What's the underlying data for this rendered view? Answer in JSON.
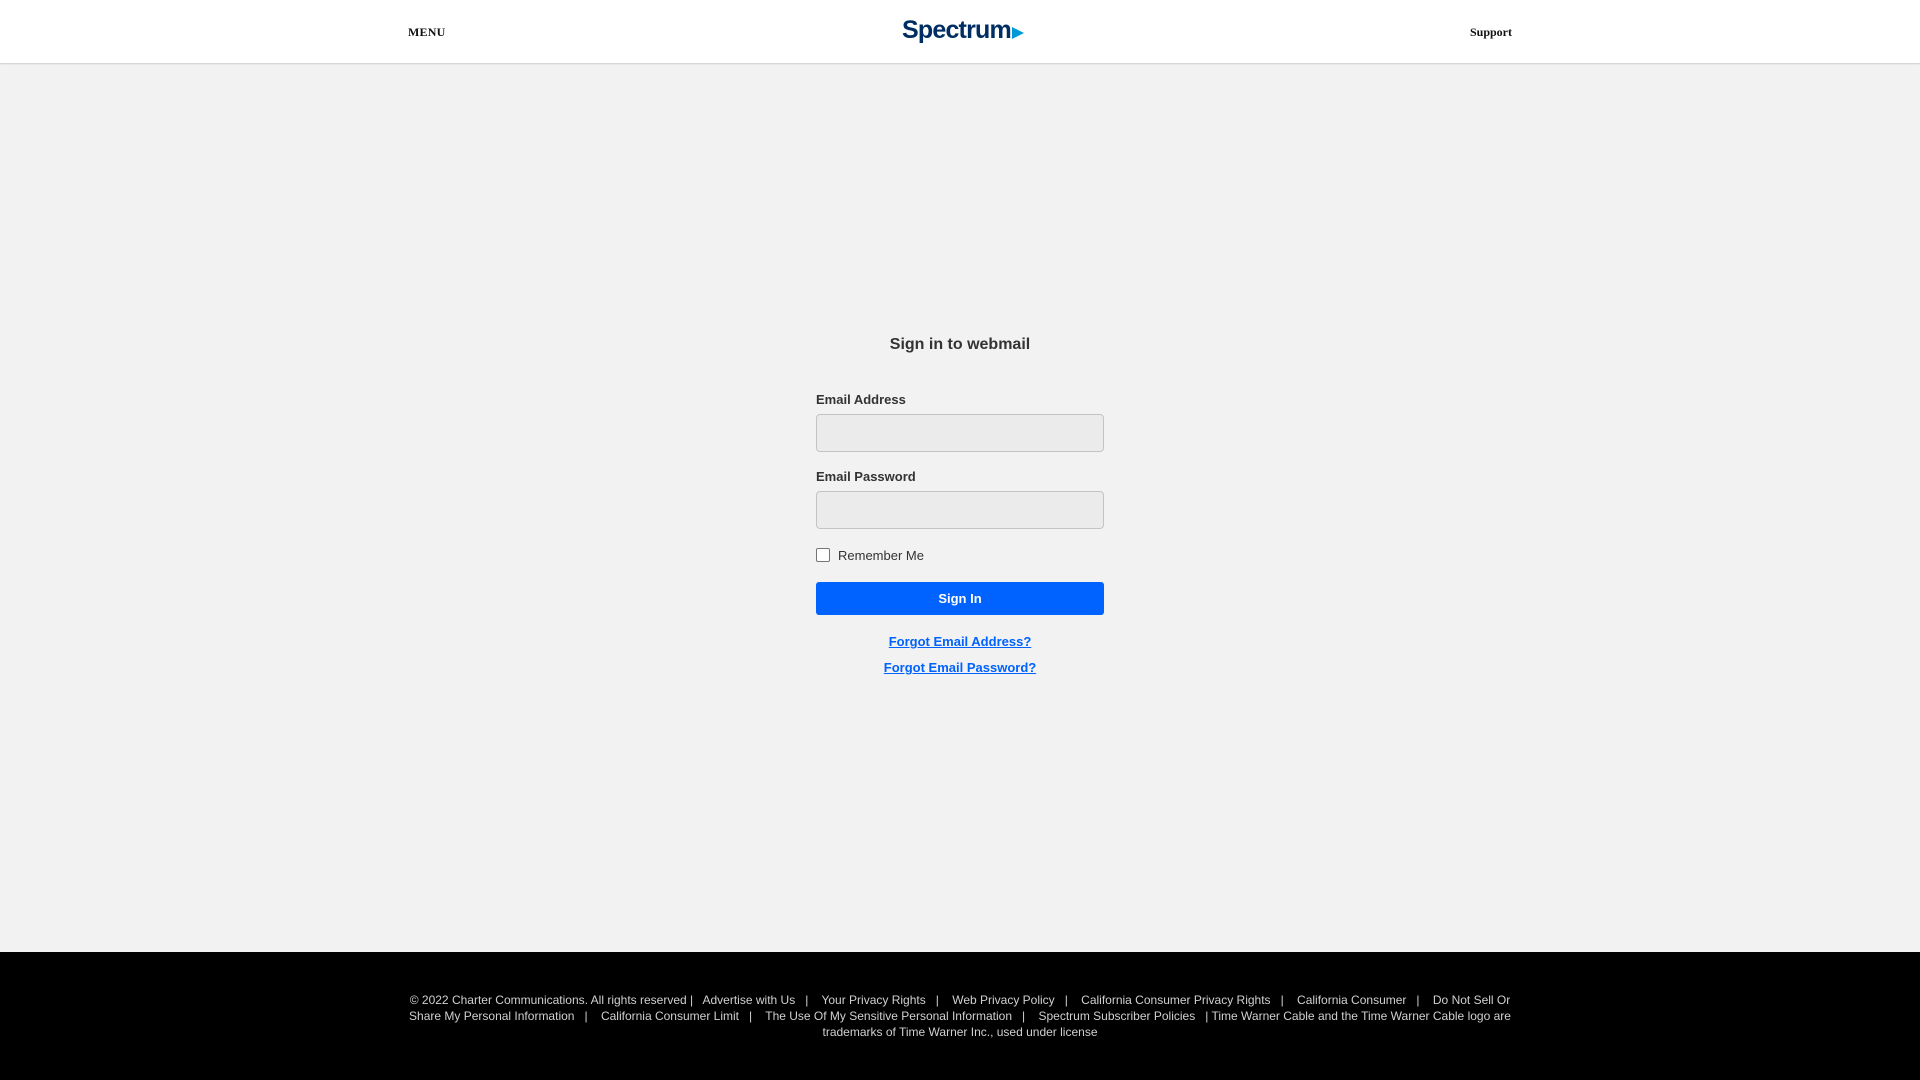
{
  "header": {
    "menu_label": "MENU",
    "brand_name": "Spectrum",
    "support_label": "Support"
  },
  "form": {
    "title": "Sign in to webmail",
    "email_label": "Email Address",
    "email_value": "",
    "password_label": "Email Password",
    "password_value": "",
    "remember_label": "Remember Me",
    "remember_checked": false,
    "signin_label": "Sign In",
    "forgot_email": "Forgot Email Address?",
    "forgot_password": "Forgot Email Password?"
  },
  "footer": {
    "copyright": "© 2022 Charter Communications. All rights reserved",
    "links": [
      "Advertise with Us",
      "Your Privacy Rights",
      "Web Privacy Policy",
      "California Consumer Privacy Rights",
      "California Consumer",
      "Do Not Sell Or Share My Personal Information",
      "California Consumer Limit",
      "The Use Of My Sensitive Personal Information",
      "Spectrum Subscriber Policies"
    ],
    "trademark": "Time Warner Cable and the Time Warner Cable logo are trademarks of Time Warner Inc., used under license"
  },
  "colors": {
    "brand_navy": "#002d62",
    "brand_arrow": "#0099d8",
    "primary_button": "#0062ff",
    "page_background": "#f2f2f2",
    "footer_background": "#000000"
  }
}
